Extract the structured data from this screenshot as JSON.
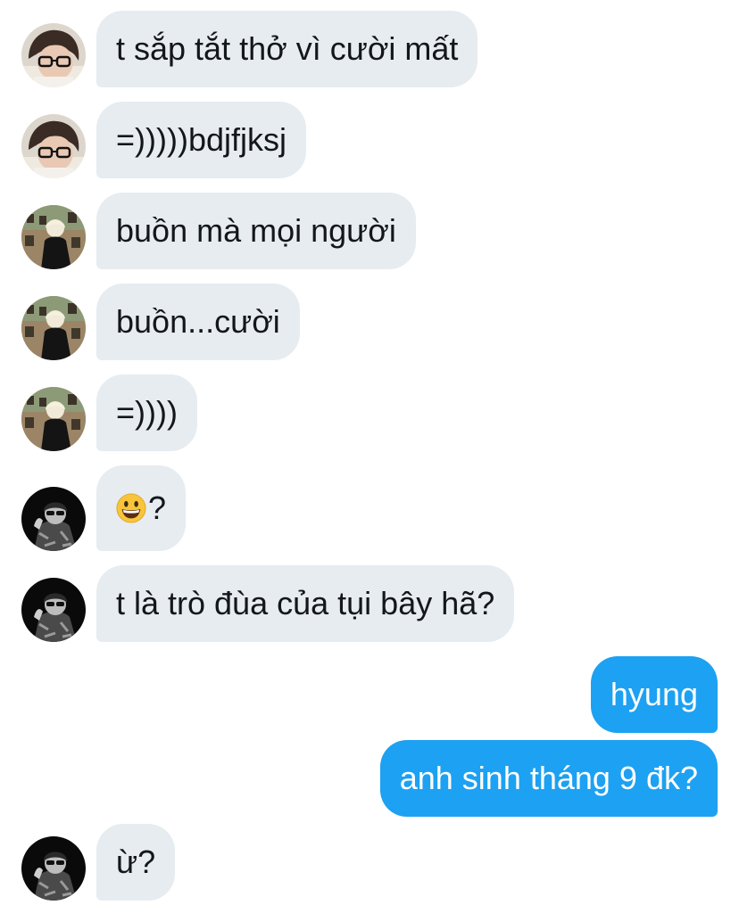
{
  "messages": [
    {
      "direction": "in",
      "sender": "user-glasses",
      "text": "t sắp tắt thở vì cười mất"
    },
    {
      "direction": "in",
      "sender": "user-glasses",
      "text": "=)))))bdjfjksj"
    },
    {
      "direction": "in",
      "sender": "user-blonde",
      "text": "buồn mà mọi người"
    },
    {
      "direction": "in",
      "sender": "user-blonde",
      "text": "buồn...cười"
    },
    {
      "direction": "in",
      "sender": "user-blonde",
      "text": "=))))"
    },
    {
      "direction": "in",
      "sender": "user-dark",
      "emoji": "grinning-face-emoji",
      "text": "?"
    },
    {
      "direction": "in",
      "sender": "user-dark",
      "text": "t là trò đùa của tụi bây hã?"
    },
    {
      "direction": "out",
      "text": "hyung"
    },
    {
      "direction": "out",
      "text": "anh sinh tháng 9 đk?"
    },
    {
      "direction": "in",
      "sender": "user-dark",
      "text": "ừ?"
    }
  ],
  "colors": {
    "incoming_bubble": "#e6ecf0",
    "outgoing_bubble": "#1da1f2",
    "incoming_text": "#14171a",
    "outgoing_text": "#ffffff"
  }
}
